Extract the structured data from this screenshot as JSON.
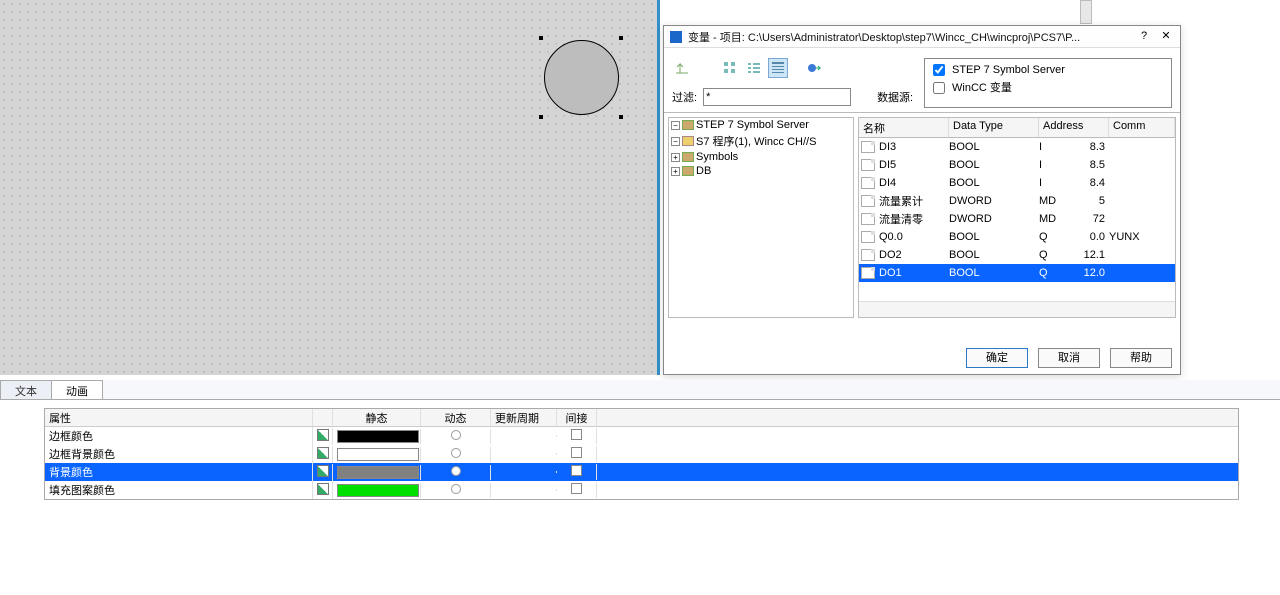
{
  "dialog": {
    "title": "变量 - 项目: C:\\Users\\Administrator\\Desktop\\step7\\Wincc_CH\\wincproj\\PCS7\\P...",
    "help_btn": "?",
    "close_btn": "✕",
    "filter_label": "过滤:",
    "filter_value": "*",
    "datasource_label": "数据源:",
    "ds_option1": "STEP 7 Symbol Server",
    "ds_option2": "WinCC 变量",
    "buttons": {
      "ok": "确定",
      "cancel": "取消",
      "help": "帮助"
    }
  },
  "tree": {
    "root": "STEP 7 Symbol Server",
    "s7prog": "S7 程序(1), Wincc CH//S",
    "symbols": "Symbols",
    "db": "DB"
  },
  "grid": {
    "headers": {
      "name": "名称",
      "type": "Data Type",
      "addr": "Address",
      "comment": "Comm"
    },
    "rows": [
      {
        "name": "DI3",
        "type": "BOOL",
        "a1": "I",
        "a2": "8.3",
        "com": ""
      },
      {
        "name": "DI5",
        "type": "BOOL",
        "a1": "I",
        "a2": "8.5",
        "com": ""
      },
      {
        "name": "DI4",
        "type": "BOOL",
        "a1": "I",
        "a2": "8.4",
        "com": ""
      },
      {
        "name": "流量累计",
        "type": "DWORD",
        "a1": "MD",
        "a2": "5",
        "com": ""
      },
      {
        "name": "流量清零",
        "type": "DWORD",
        "a1": "MD",
        "a2": "72",
        "com": ""
      },
      {
        "name": "Q0.0",
        "type": "BOOL",
        "a1": "Q",
        "a2": "0.0",
        "com": "YUNX"
      },
      {
        "name": "DO2",
        "type": "BOOL",
        "a1": "Q",
        "a2": "12.1",
        "com": ""
      },
      {
        "name": "DO1",
        "type": "BOOL",
        "a1": "Q",
        "a2": "12.0",
        "com": "",
        "selected": true
      }
    ]
  },
  "tabs": {
    "text": "文本",
    "anim": "动画"
  },
  "props": {
    "headers": {
      "prop": "属性",
      "static": "静态",
      "dyn": "动态",
      "upd": "更新周期",
      "ind": "间接"
    },
    "rows": [
      {
        "label": "边框颜色",
        "color": "#000000",
        "selected": false
      },
      {
        "label": "边框背景颜色",
        "color": "#ffffff",
        "selected": false
      },
      {
        "label": "背景颜色",
        "color": "#808080",
        "selected": true
      },
      {
        "label": "填充图案颜色",
        "color": "#00e000",
        "selected": false
      }
    ]
  }
}
